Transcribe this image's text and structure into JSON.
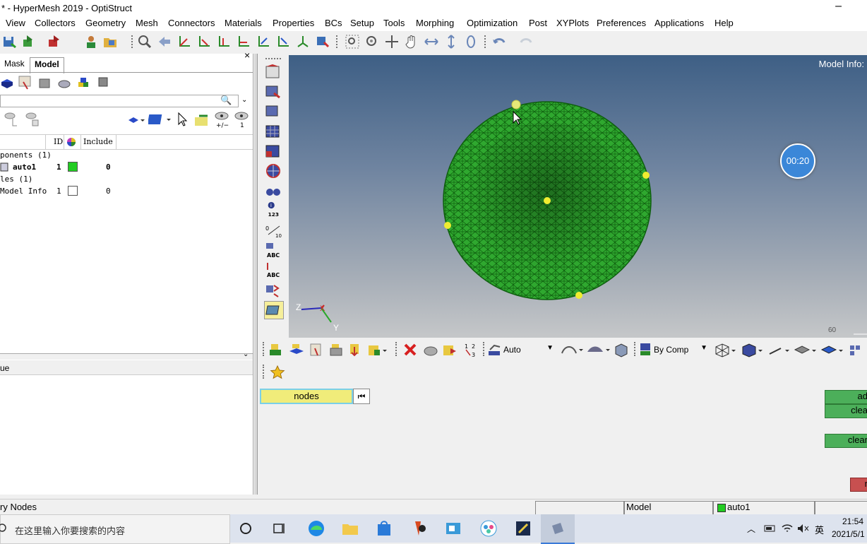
{
  "window": {
    "title": "* - HyperMesh 2019 - OptiStruct",
    "minimize_glyph": "–"
  },
  "menu": {
    "items": [
      "View",
      "Collectors",
      "Geometry",
      "Mesh",
      "Connectors",
      "Materials",
      "Properties",
      "BCs",
      "Setup",
      "Tools",
      "Morphing",
      "Optimization",
      "Post",
      "XYPlots",
      "Preferences",
      "Applications",
      "Help"
    ]
  },
  "left_panel": {
    "tabs": [
      "Mask",
      "Model"
    ],
    "close_glyph": "×",
    "table_headers": {
      "id": "ID",
      "include": "Include"
    },
    "tree": {
      "components_label": "ponents (1)",
      "comp_name": "auto1",
      "comp_id": "1",
      "comp_include": "0",
      "titles_label": "les (1)",
      "modelinfo_name": "Model Info",
      "modelinfo_id": "1",
      "modelinfo_include": "0"
    },
    "lower_header": "ue"
  },
  "viewport": {
    "model_info": "Model Info:",
    "timer": "00:20",
    "axis_z": "Z",
    "axis_x": "X",
    "axis_y": "Y",
    "scale_label": "60"
  },
  "bottom_toolbar": {
    "auto_select": "Auto",
    "color_mode": "By Comp"
  },
  "command_panel": {
    "selector_label": "nodes",
    "btn_add": "ad",
    "btn_clear1": "clea",
    "btn_clear2": "clear",
    "btn_red": "r"
  },
  "status": {
    "left": "ry Nodes",
    "model": "Model",
    "component": "auto1",
    "comp_color": "#22cc22"
  },
  "taskbar": {
    "search_placeholder": "在这里输入你要搜索的内容",
    "time": "21:54",
    "date": "2021/5/1",
    "ime": "英"
  },
  "colors": {
    "mesh_green": "#2fa82f",
    "accent_yellow": "#f0ec7a"
  }
}
